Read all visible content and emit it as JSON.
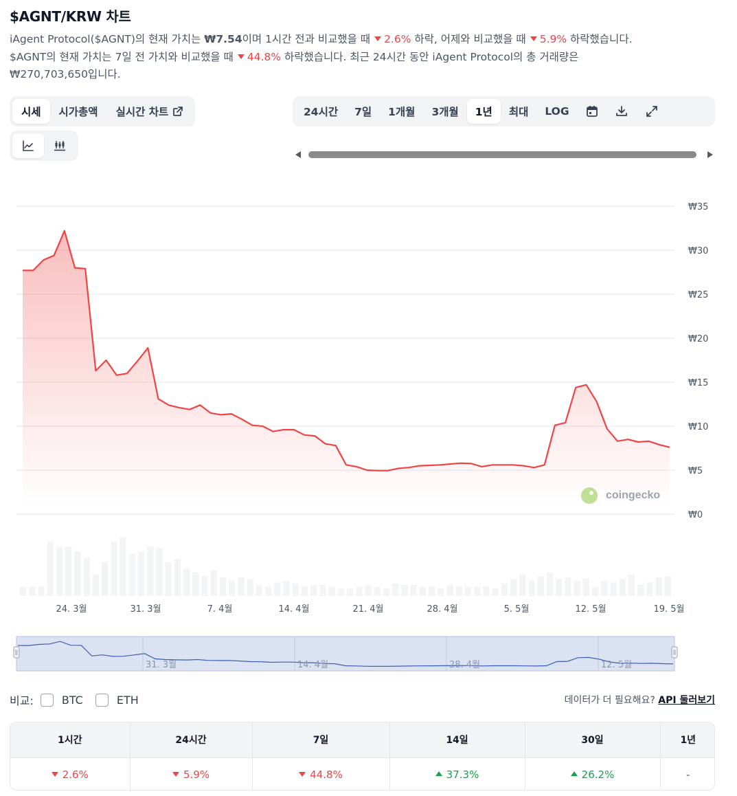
{
  "title": "$AGNT/KRW 차트",
  "description": {
    "line1_a": "iAgent Protocol($AGNT)의 현재 가치는 ",
    "price": "₩7.54",
    "line1_b": "이며 1시간 전과 비교했을 때",
    "change_1h": "2.6%",
    "line1_c": " 하락, 어제와 비교했을 때",
    "change_24h": "5.9%",
    "line1_d": " 하락했습니다.",
    "line2_a": "$AGNT의 현재 가치는 7일 전 가치와 비교했을 때",
    "change_7d": "44.8%",
    "line2_b": " 하락했습니다. 최근 24시간 동안 iAgent Protocol의 총 거래량은",
    "volume": "₩270,703,650입니다."
  },
  "view_tabs": [
    {
      "label": "시세",
      "active": true
    },
    {
      "label": "시가총액",
      "active": false
    },
    {
      "label": "실시간 차트",
      "active": false
    }
  ],
  "range_tabs": [
    {
      "label": "24시간",
      "active": false
    },
    {
      "label": "7일",
      "active": false
    },
    {
      "label": "1개월",
      "active": false
    },
    {
      "label": "3개월",
      "active": false
    },
    {
      "label": "1년",
      "active": true
    },
    {
      "label": "최대",
      "active": false
    },
    {
      "label": "LOG",
      "active": false
    }
  ],
  "range_icons": [
    "calendar-icon",
    "download-icon",
    "expand-icon"
  ],
  "chart_type_icons": [
    "line-chart-icon",
    "candlestick-icon"
  ],
  "colors": {
    "line": "#ef4444",
    "volume": "#f3f4f6",
    "navigator_fill": "#dbe2f2",
    "navigator_line": "#3b5bb5",
    "negative": "#ef4444",
    "positive": "#16a34a"
  },
  "chart_data": {
    "type": "line",
    "y_ticks": [
      "₩35",
      "₩30",
      "₩25",
      "₩20",
      "₩15",
      "₩10",
      "₩5",
      "₩0"
    ],
    "ylim": [
      0,
      35
    ],
    "x_ticks": [
      "24. 3월",
      "31. 3월",
      "7. 4월",
      "14. 4월",
      "21. 4월",
      "28. 4월",
      "5. 5월",
      "12. 5월",
      "19. 5월"
    ],
    "navigator_ticks": [
      "31. 3월",
      "14. 4월",
      "28. 4월",
      "12. 5월"
    ],
    "watermark": "coingecko",
    "series": [
      {
        "values": [
          27.7,
          27.7,
          28.9,
          29.4,
          32.2,
          28.0,
          27.9,
          16.3,
          17.5,
          15.8,
          16.0,
          17.4,
          18.9,
          13.1,
          12.4,
          12.1,
          11.9,
          12.4,
          11.5,
          11.3,
          11.4,
          10.8,
          10.1,
          10.0,
          9.4,
          9.6,
          9.6,
          9.0,
          8.9,
          8.0,
          7.8,
          5.6,
          5.4,
          5.0,
          4.95,
          4.95,
          5.2,
          5.3,
          5.5,
          5.55,
          5.6,
          5.7,
          5.8,
          5.75,
          5.4,
          5.6,
          5.6,
          5.6,
          5.5,
          5.3,
          5.6,
          10.1,
          10.4,
          14.4,
          14.7,
          12.8,
          9.7,
          8.3,
          8.5,
          8.2,
          8.3,
          7.9,
          7.6
        ]
      }
    ],
    "volume_bars": [
      0.15,
      0.15,
      0.15,
      0.88,
      0.8,
      0.8,
      0.72,
      0.62,
      0.35,
      0.55,
      0.88,
      0.95,
      0.68,
      0.72,
      0.8,
      0.78,
      0.55,
      0.6,
      0.45,
      0.38,
      0.32,
      0.42,
      0.3,
      0.25,
      0.3,
      0.28,
      0.18,
      0.15,
      0.22,
      0.25,
      0.2,
      0.15,
      0.18,
      0.18,
      0.15,
      0.12,
      0.12,
      0.15,
      0.18,
      0.15,
      0.12,
      0.2,
      0.18,
      0.18,
      0.15,
      0.15,
      0.12,
      0.18,
      0.15,
      0.15,
      0.15,
      0.15,
      0.12,
      0.2,
      0.28,
      0.35,
      0.25,
      0.32,
      0.38,
      0.28,
      0.3,
      0.25,
      0.28,
      0.15,
      0.25,
      0.22,
      0.28,
      0.35,
      0.18,
      0.22,
      0.3,
      0.32
    ]
  },
  "compare": {
    "label": "비교:",
    "options": [
      "BTC",
      "ETH"
    ]
  },
  "api_text": "데이터가 더 필요해요?",
  "api_link": "API 둘러보기",
  "performance": {
    "headers": [
      "1시간",
      "24시간",
      "7일",
      "14일",
      "30일",
      "1년"
    ],
    "values": [
      {
        "text": "2.6%",
        "dir": "down"
      },
      {
        "text": "5.9%",
        "dir": "down"
      },
      {
        "text": "44.8%",
        "dir": "down"
      },
      {
        "text": "37.3%",
        "dir": "up"
      },
      {
        "text": "26.2%",
        "dir": "up"
      },
      {
        "text": "-",
        "dir": "none"
      }
    ]
  }
}
